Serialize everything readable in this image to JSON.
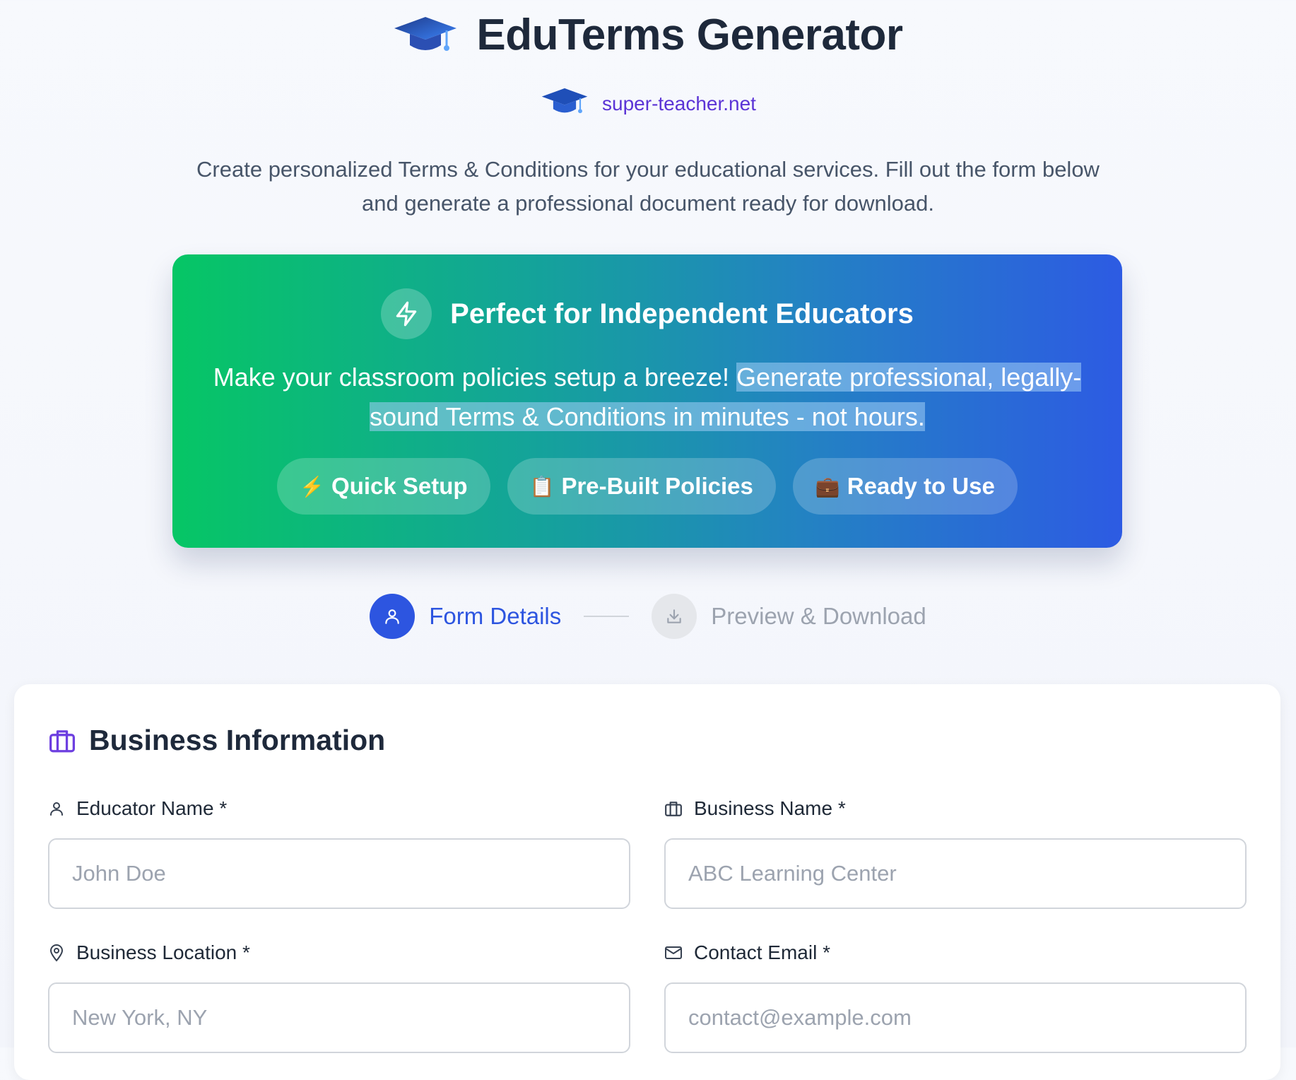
{
  "header": {
    "title": "EduTerms Generator",
    "logo_icon": "graduation-cap-icon",
    "site_link": "super-teacher.net",
    "intro": "Create personalized Terms & Conditions for your educational services. Fill out the form below and generate a professional document ready for download."
  },
  "promo": {
    "icon": "lightning-bolt-icon",
    "title": "Perfect for Independent Educators",
    "text_plain": "Make your classroom policies setup a breeze! ",
    "text_highlighted": "Generate professional, legally-sound Terms & Conditions in minutes - not hours.",
    "pills": [
      {
        "emoji": "⚡",
        "label": "Quick Setup"
      },
      {
        "emoji": "📋",
        "label": "Pre-Built Policies"
      },
      {
        "emoji": "💼",
        "label": "Ready to Use"
      }
    ]
  },
  "stepper": {
    "steps": [
      {
        "label": "Form Details",
        "icon": "user-icon",
        "state": "active"
      },
      {
        "label": "Preview & Download",
        "icon": "download-icon",
        "state": "inactive"
      }
    ]
  },
  "form": {
    "section_title": "Business Information",
    "section_icon": "briefcase-icon",
    "fields": [
      {
        "label": "Educator Name *",
        "icon": "user-icon",
        "value": "",
        "placeholder": "John Doe"
      },
      {
        "label": "Business Name *",
        "icon": "building-icon",
        "value": "",
        "placeholder": "ABC Learning Center"
      },
      {
        "label": "Business Location *",
        "icon": "map-pin-icon",
        "value": "",
        "placeholder": "New York, NY"
      },
      {
        "label": "Contact Email *",
        "icon": "mail-icon",
        "value": "",
        "placeholder": "contact@example.com"
      }
    ]
  },
  "colors": {
    "primary": "#2d55e0",
    "site_link": "#5b34d6",
    "promo_gradient_start": "#06c665",
    "promo_gradient_end": "#2d5be3"
  }
}
